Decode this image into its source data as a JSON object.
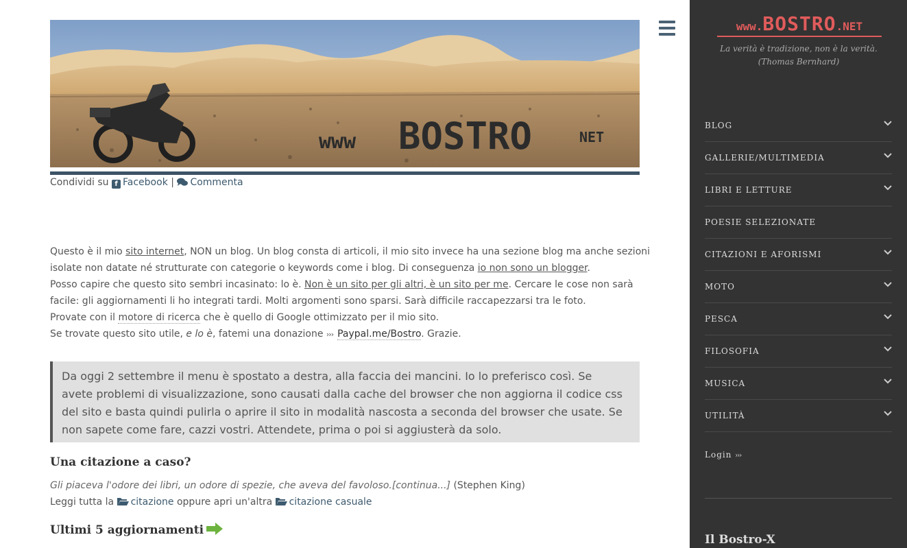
{
  "banner": {
    "logo_www": "www",
    "logo_main": "BOSTRO",
    "logo_net": "NET"
  },
  "share": {
    "prefix": "Condividi su",
    "facebook": "Facebook",
    "separator": "|",
    "comment": "Commenta"
  },
  "intro": {
    "l1_a": "Questo è il mio ",
    "l1_link": "sito internet",
    "l1_b": ", NON un blog. Un blog consta di articoli, il mio sito invece ha una sezione blog ma anche sezioni",
    "l2_a": "isolate non datate né strutturate con categorie o keywords come i blog. Di conseguenza ",
    "l2_link": "io non sono un blogger",
    "l2_b": ".",
    "l3_a": "Posso capire che questo sito sembri incasinato: lo è. ",
    "l3_link": "Non è un sito per gli altri, è un sito per me",
    "l3_b": ". Cercare le cose non sarà",
    "l4": "facile: gli aggiornamenti li ho integrati tardi. Molti argomenti sono sparsi. Sarà difficile raccapezzarsi tra le foto.",
    "l5_a": "Provate con il ",
    "l5_link": "motore di ricerca",
    "l5_b": " che è quello di Google ottimizzato per il mio sito.",
    "l6_a": "Se trovate questo sito utile, ",
    "l6_em": "e lo è",
    "l6_b": ", fatemi una donazione ",
    "l6_arrows": "›››",
    "l6_link": "Paypal.me/Bostro",
    "l6_c": ". Grazie."
  },
  "notice": {
    "lines": [
      "Da oggi 2 settembre il menu è spostato a destra, alla faccia dei mancini. Io lo preferisco così. Se",
      "avete problemi di visualizzazione, sono causati dalla cache del browser che non aggiorna il codice css",
      "del sito e basta quindi pulirla o aprire il sito in modalità nascosta a seconda del browser che usate. Se",
      "non sapete come fare, cazzi vostri. Attendete, prima o poi si aggiusterà da solo."
    ]
  },
  "quote": {
    "title": "Una citazione a caso?",
    "text": "Gli piaceva l'odore dei libri, un odore di spezie, che aveva del favoloso.",
    "more": "[continua...]",
    "author": " (Stephen King)",
    "read_prefix": "Leggi tutta la ",
    "link1": "citazione",
    "middle": " oppure apri un'altra ",
    "link2": "citazione casuale"
  },
  "updates": {
    "title": "Ultimi 5 aggiornamenti"
  },
  "sidebar": {
    "logo_small": "www.",
    "logo_big": "BOSTRO",
    "logo_tld": ".NET",
    "tagline": "La verità è tradizione, non è la verità. (Thomas Bernhard)",
    "nav": [
      {
        "label": "BLOG",
        "has_children": true
      },
      {
        "label": "GALLERIE/MULTIMEDIA",
        "has_children": true
      },
      {
        "label": "LIBRI E LETTURE",
        "has_children": true
      },
      {
        "label": "POESIE SELEZIONATE",
        "has_children": false
      },
      {
        "label": "CITAZIONI E AFORISMI",
        "has_children": true
      },
      {
        "label": "MOTO",
        "has_children": true
      },
      {
        "label": "PESCA",
        "has_children": true
      },
      {
        "label": "FILOSOFIA",
        "has_children": true
      },
      {
        "label": "MUSICA",
        "has_children": true
      },
      {
        "label": "UTILITÀ",
        "has_children": true
      }
    ],
    "login": "Login",
    "login_arrows": "›››",
    "widget_title": "Il Bostro-X"
  },
  "colors": {
    "sidebar_bg": "#333333",
    "logo_red": "#e15b5b",
    "link": "#3d5a6e",
    "notice_bg": "#e0e0e0"
  },
  "icons": [
    "facebook-icon",
    "comment-icon",
    "folder-open-icon",
    "arrow-right-icon",
    "hamburger-icon",
    "chevron-down-icon"
  ]
}
